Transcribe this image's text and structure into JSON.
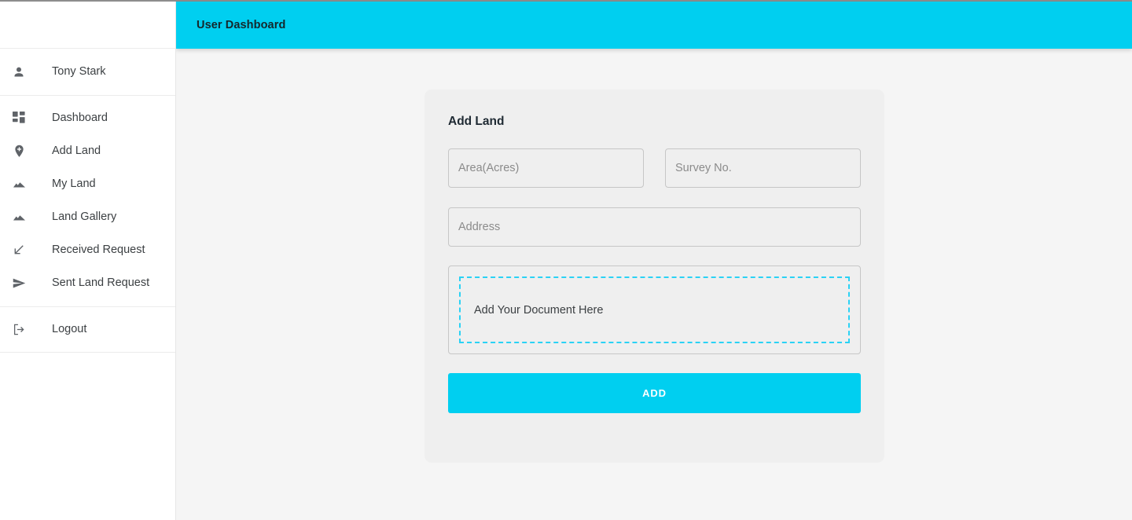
{
  "theme": {
    "accent": "#00cff0",
    "dashed_border": "#2ad2f5",
    "page_bg": "#f5f5f5",
    "card_bg": "#efefef",
    "sidebar_bg": "#ffffff",
    "text": "#3c4043",
    "placeholder": "#8b8b8b"
  },
  "topbar": {
    "title": "User Dashboard"
  },
  "sidebar": {
    "user": {
      "name": "Tony Stark",
      "icon": "person-icon"
    },
    "items": [
      {
        "label": "Dashboard",
        "icon": "dashboard-grid-icon"
      },
      {
        "label": "Add Land",
        "icon": "location-pin-add-icon"
      },
      {
        "label": "My Land",
        "icon": "terrain-icon"
      },
      {
        "label": "Land Gallery",
        "icon": "terrain-icon"
      },
      {
        "label": "Received Request",
        "icon": "call-received-arrow-icon"
      },
      {
        "label": "Sent Land Request",
        "icon": "send-plane-icon"
      }
    ],
    "logout": {
      "label": "Logout",
      "icon": "logout-icon"
    }
  },
  "card": {
    "title": "Add Land",
    "fields": {
      "area": {
        "placeholder": "Area(Acres)",
        "value": ""
      },
      "survey": {
        "placeholder": "Survey No.",
        "value": ""
      },
      "address": {
        "placeholder": "Address",
        "value": ""
      }
    },
    "dropzone": {
      "label": "Add Your Document Here"
    },
    "submit_label": "ADD"
  }
}
